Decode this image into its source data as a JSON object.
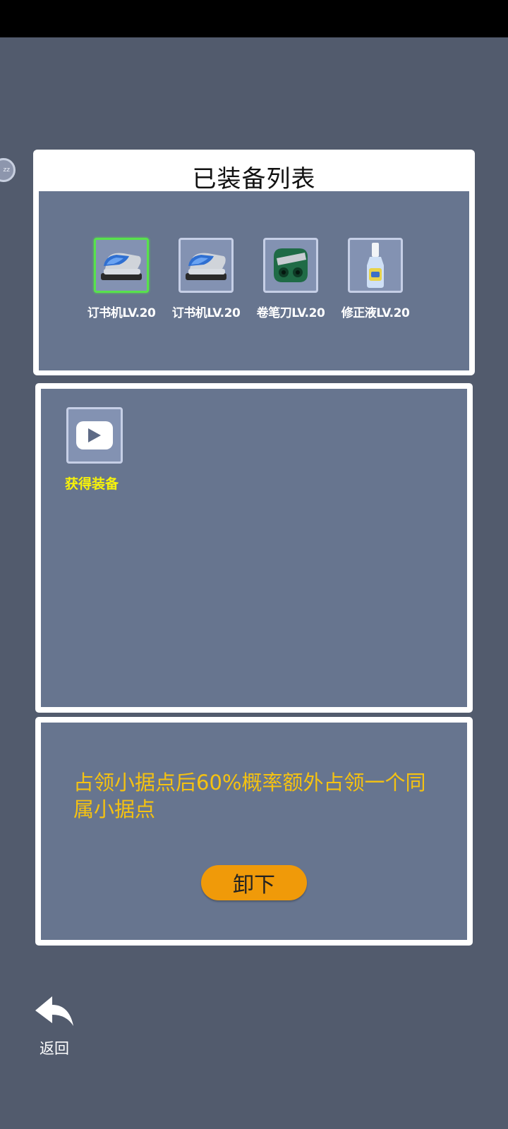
{
  "equipped": {
    "title": "已装备列表",
    "items": [
      {
        "name": "订书机LV.20",
        "icon": "stapler-icon",
        "selected": true
      },
      {
        "name": "订书机LV.20",
        "icon": "stapler-icon",
        "selected": false
      },
      {
        "name": "卷笔刀LV.20",
        "icon": "pencil-sharpener-icon",
        "selected": false
      },
      {
        "name": "修正液LV.20",
        "icon": "correction-fluid-icon",
        "selected": false
      }
    ]
  },
  "inventory": {
    "get_equipment_label": "获得装备",
    "get_equipment_icon": "video-play-icon"
  },
  "description": {
    "text": "占领小据点后60%概率额外占领一个同属小据点",
    "unequip_label": "卸下"
  },
  "navigation": {
    "back_label": "返回",
    "back_icon": "back-arrow-icon"
  },
  "side_badge": {
    "text": "zz"
  },
  "colors": {
    "background": "#525b6d",
    "panel": "#67758f",
    "selected_border": "#58e24c",
    "accent_text": "#f6f20a",
    "description_text": "#f5c211",
    "button": "#f09a09"
  }
}
